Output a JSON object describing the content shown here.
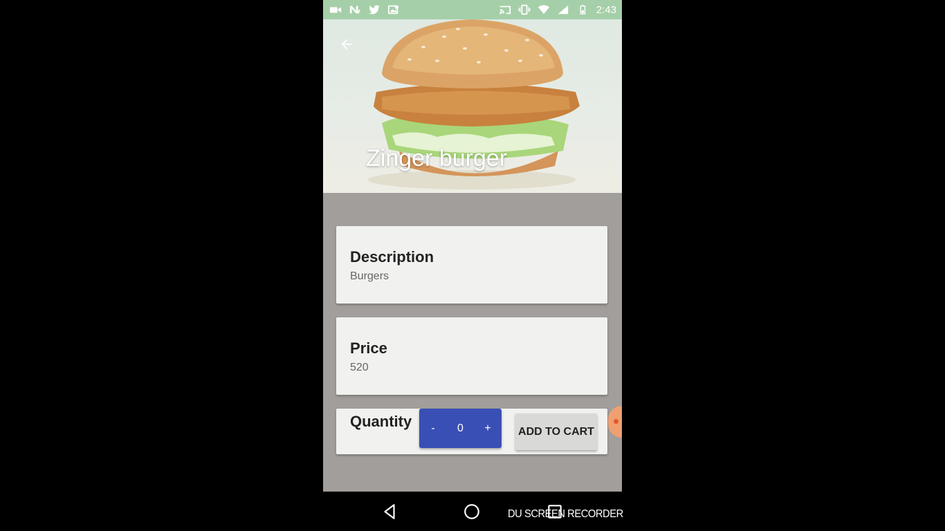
{
  "status_bar": {
    "left_icons": [
      "video-icon",
      "n-notification-icon",
      "twitter-icon",
      "image-icon"
    ],
    "right_icons": [
      "cast-icon",
      "vibrate-icon",
      "wifi-icon",
      "signal-icon",
      "battery-icon"
    ],
    "time": "2:43"
  },
  "hero": {
    "title": "Zinger burger",
    "back_icon": "arrow-back-icon"
  },
  "description": {
    "title": "Description",
    "value": "Burgers"
  },
  "price": {
    "title": "Price",
    "value": "520"
  },
  "quantity": {
    "label": "Quantity",
    "minus": "-",
    "value": "0",
    "plus": "+",
    "add_to_cart": "ADD TO CART"
  },
  "nav": {
    "back_icon": "nav-back-icon",
    "home_icon": "nav-home-icon",
    "recents_icon": "nav-recents-icon"
  },
  "watermark": "DU SCREEN RECORDER",
  "colors": {
    "status_bar": "#a5cfa8",
    "content_bg": "#a19e9b",
    "card_bg": "#f1f1ef",
    "stepper": "#3a4fb5",
    "add_cart_bg": "#d9d9d7",
    "fab_accent": "#f0a070"
  }
}
